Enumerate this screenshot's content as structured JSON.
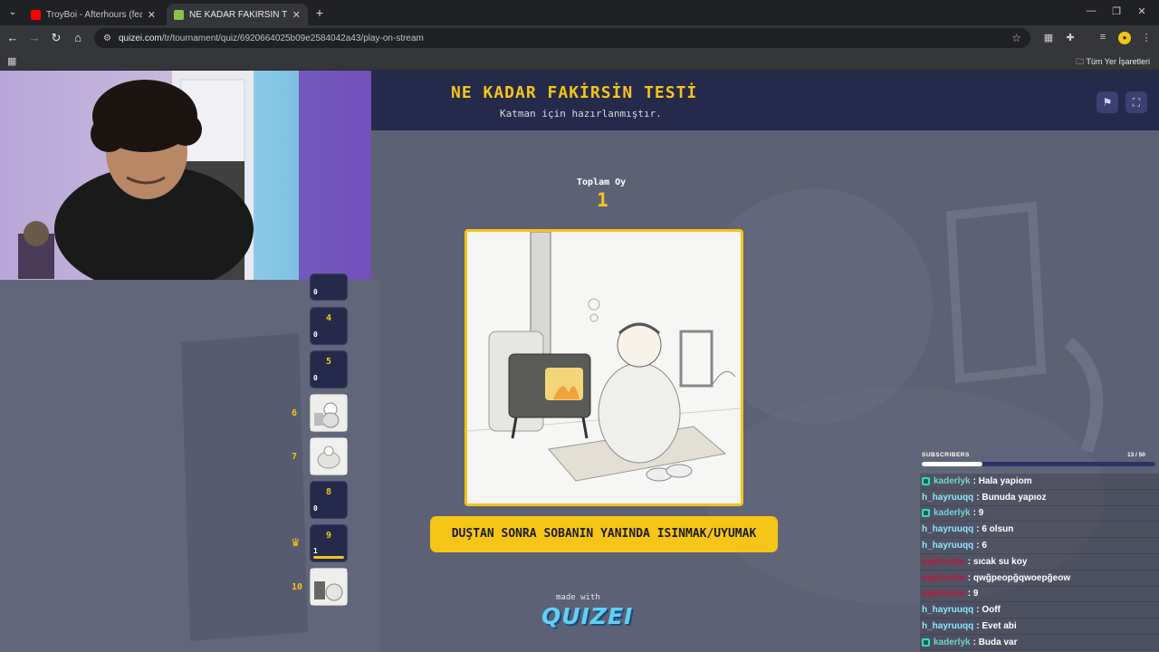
{
  "browser": {
    "tabs": [
      {
        "label": "TroyBoi - Afterhours (feat. Diplo",
        "favicon_color": "#ff0000",
        "active": false
      },
      {
        "label": "NE KADAR FAKİRSİN TESTİ - Tu",
        "favicon_color": "#8bc34a",
        "active": true
      }
    ],
    "new_tab_symbol": "+",
    "url": {
      "host": "quizei.com",
      "path": "/tr/tournament/quiz/6920664025b09e2584042a43/play-on-stream"
    },
    "bookmarks_all_label": "Tüm Yer İşaretleri"
  },
  "quiz": {
    "title": "NE KADAR FAKİRSİN TESTİ",
    "subtitle": "Katman için hazırlanmıştır.",
    "votes_label": "Toplam Oy",
    "votes_value": "1",
    "answer": "DUŞTAN SONRA SOBANIN YANINDA ISINMAK/UYUMAK",
    "made_with": "made with",
    "logo": "QUIZEI"
  },
  "bracket": [
    {
      "number": "",
      "count": "0",
      "type": "card",
      "partial": true
    },
    {
      "number": "4",
      "count": "0",
      "type": "card"
    },
    {
      "number": "5",
      "count": "0",
      "type": "card"
    },
    {
      "number": "",
      "count": "",
      "type": "thumb",
      "rank": "6"
    },
    {
      "number": "",
      "count": "",
      "type": "thumb",
      "rank": "7"
    },
    {
      "number": "8",
      "count": "0",
      "type": "card"
    },
    {
      "number": "9",
      "count": "1",
      "type": "card",
      "crowned": true,
      "vote_share": 1.0
    },
    {
      "number": "",
      "count": "",
      "type": "thumb",
      "rank": "10"
    }
  ],
  "subscribers": {
    "label": "SUBSCRIBERS",
    "current": 13,
    "goal": 50,
    "display": "13 / 50"
  },
  "chat": [
    {
      "user": "kaderlyk",
      "text": "Hala yapiom",
      "color": "#6fd6c8",
      "badge": true
    },
    {
      "user": "h_hayruuqq",
      "text": "Bunuda yapıoz",
      "color": "#8fe3ff",
      "badge": false
    },
    {
      "user": "kaderlyk",
      "text": "9",
      "color": "#6fd6c8",
      "badge": true
    },
    {
      "user": "h_hayruuqq",
      "text": "6 olsun",
      "color": "#8fe3ff",
      "badge": false
    },
    {
      "user": "h_hayruuqq",
      "text": "6",
      "color": "#8fe3ff",
      "badge": false
    },
    {
      "user": "yigitoroke",
      "text": "sıcak su koy",
      "color": "#c0183a",
      "badge": false
    },
    {
      "user": "yigitoroke",
      "text": "qwğpeopğqwoepğeow",
      "color": "#c0183a",
      "badge": false
    },
    {
      "user": "yigitoroke",
      "text": "9",
      "color": "#c0183a",
      "badge": false
    },
    {
      "user": "h_hayruuqq",
      "text": "Ooff",
      "color": "#8fe3ff",
      "badge": false
    },
    {
      "user": "h_hayruuqq",
      "text": "Evet abi",
      "color": "#8fe3ff",
      "badge": false
    },
    {
      "user": "kaderlyk",
      "text": "Buda var",
      "color": "#6fd6c8",
      "badge": true
    }
  ],
  "colors": {
    "accent": "#f5c518",
    "header_bg": "#262a4a",
    "page_bg": "#5b5f73"
  }
}
